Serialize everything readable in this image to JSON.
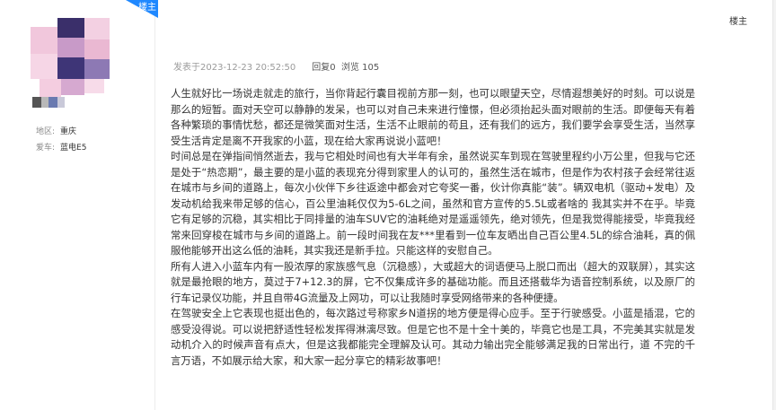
{
  "post": {
    "badge": "楼主",
    "floor_label": "楼主",
    "author": {
      "region_label": "地区:",
      "region": "重庆",
      "car_label": "爱车:",
      "car": "蓝电E5"
    },
    "meta": {
      "posted": "发表于2023-12-23 20:52:50",
      "replies": "回复0",
      "views": "浏览 105"
    },
    "paragraphs": [
      "人生就好比一场说走就走的旅行，当你背起行囊目视前方那一刻，也可以眼望天空，尽情遐想美好的时刻。可以说是那么的短暂。面对天空可以静静的发呆，也可以对自己未来进行憧憬，但必须抬起头面对眼前的生活。即便每天有着各种繁琐的事情忧愁，都还是微笑面对生活，生活不止眼前的苟且，还有我们的远方，我们要学会享受生活，当然享受生活肯定是离不开我家的小蓝，现在给大家再说说小蓝吧！",
      "时间总是在弹指间悄然逝去，我与它相处时间也有大半年有余，虽然说买车到现在驾驶里程约小万公里，但我与它还是处于“热恋期”，最主要的是小蓝的表现充分得到家里人的认可的，虽然生活在城市，但是作为农村孩子会经常往返在城市与乡间的道路上，每次小伙伴下乡往返途中都会对它夸奖一番，伙计你真能“装”。辆双电机（驱动+发电）及发动机给我来带足够的信心，百公里油耗仅仅为5-6L之间，虽然和官方宣传的5.5L或者啥的 我其实并不在乎。毕竟它有足够的沉稳，其实相比于同排量的油车SUV它的油耗绝对是遥遥领先，绝对领先，但是我觉得能接受，毕竟我经常来回穿梭在城市与乡间的道路上。前一段时间我在友***里看到一位车友晒出自己百公里4.5L的综合油耗，真的佩服他能够开出这么低的油耗，其实我还是新手拉。只能这样的安慰自己。",
      "所有人进入小蓝车内有一股浓厚的家族感气息（沉稳感），大或超大的词语便马上脱口而出（超大的双联屏），其实这就是最抢眼的地方，莫过于7+12.3的屏，它不仅集成许多的基础功能。而且还搭载华为语音控制系统，以及原厂的行车记录仪功能，并且自带4G流量及上网功，可以让我随时享受网络带来的各种便捷。",
      "在驾驶安全上它表现也挺出色的，每次路过号称家乡N道拐的地方便是得心应手。至于行驶感受。小蓝是插混，它的感受没得说。可以说把舒适性轻松发挥得淋漓尽致。但是它也不是十全十美的，毕竟它也是工具，不完美其实就是发动机介入的时候声音有点大，但是这我都能完全理解及认可。其动力输出完全能够满足我的日常出行，道 不完的千言万语，不如展示给大家，和大家一起分享它的精彩故事吧！"
    ]
  }
}
